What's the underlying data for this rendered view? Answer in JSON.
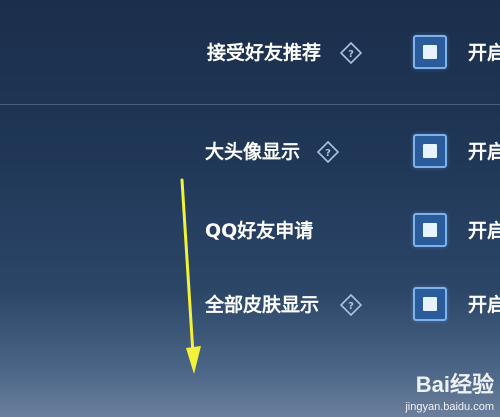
{
  "settings": {
    "items": [
      {
        "label": "接受好友推荐",
        "has_help": true,
        "checked": true,
        "state": "开启"
      },
      {
        "label": "大头像显示",
        "has_help": true,
        "checked": true,
        "state": "开启"
      },
      {
        "label": "QQ好友申请",
        "has_help": false,
        "checked": true,
        "state": "开启"
      },
      {
        "label": "全部皮肤显示",
        "has_help": true,
        "checked": true,
        "state": "开启"
      }
    ]
  },
  "annotation": {
    "arrow_color": "#f2f23a",
    "arrow_direction": "down"
  },
  "watermark": {
    "logo": "Bai经验",
    "url": "jingyan.baidu.com"
  },
  "colors": {
    "accent": "#7fb2ea",
    "checkbox_fill": "#2a5b9a",
    "background": "#1f3656"
  }
}
